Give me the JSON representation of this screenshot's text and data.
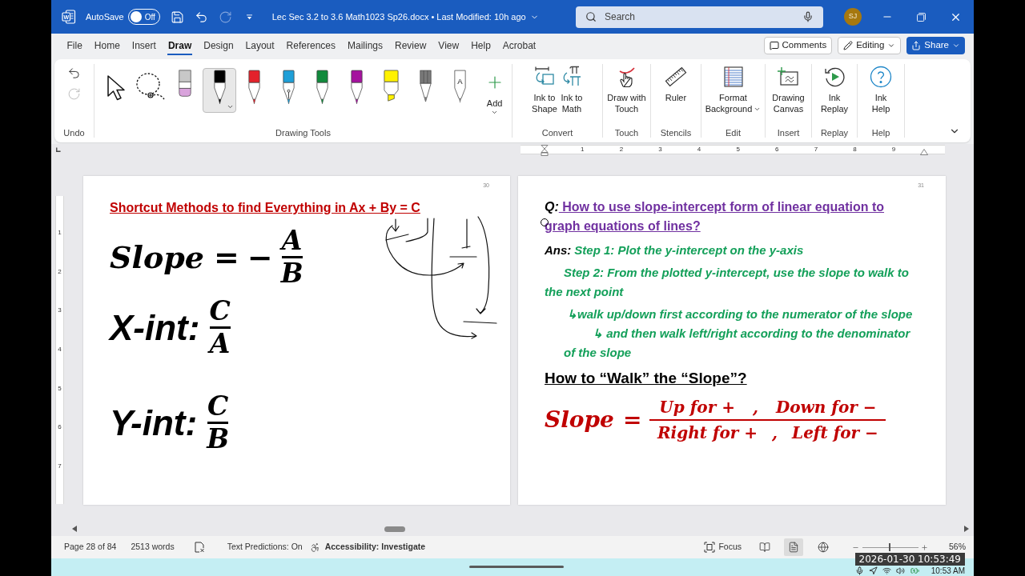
{
  "title_bar": {
    "logo_letter": "W",
    "autosave": {
      "label": "AutoSave",
      "on": false,
      "state_label": "Off"
    },
    "quick_access": [
      {
        "kind": "save",
        "disabled": false
      },
      {
        "kind": "undo",
        "disabled": false
      },
      {
        "kind": "redo",
        "disabled": true
      },
      {
        "kind": "customize",
        "disabled": false
      }
    ],
    "document_title": "Lec Sec 3.2 to 3.6 Math1023 Sp26.docx • Last Modified: 10h ago",
    "search": {
      "placeholder": "Search"
    },
    "avatar": "SJ"
  },
  "menu_tabs": [
    {
      "label": "File",
      "selected": false
    },
    {
      "label": "Home",
      "selected": false
    },
    {
      "label": "Insert",
      "selected": false
    },
    {
      "label": "Draw",
      "selected": true
    },
    {
      "label": "Design",
      "selected": false
    },
    {
      "label": "Layout",
      "selected": false
    },
    {
      "label": "References",
      "selected": false
    },
    {
      "label": "Mailings",
      "selected": false
    },
    {
      "label": "Review",
      "selected": false
    },
    {
      "label": "View",
      "selected": false
    },
    {
      "label": "Help",
      "selected": false
    },
    {
      "label": "Acrobat",
      "selected": false
    }
  ],
  "header_buttons": [
    {
      "kind": "comments",
      "label": "Comments"
    },
    {
      "kind": "editing",
      "label": "Editing"
    },
    {
      "kind": "share",
      "label": "Share"
    }
  ],
  "ribbon": {
    "undo_group": {
      "label": "Undo",
      "buttons": [
        {
          "kind": "undo",
          "disabled": false
        },
        {
          "kind": "redo",
          "disabled": true
        }
      ]
    },
    "drawing_tools": {
      "label": "Drawing Tools",
      "tools": [
        {
          "kind": "select",
          "selected": false
        },
        {
          "kind": "lasso",
          "selected": false
        },
        {
          "kind": "eraser",
          "selected": false
        },
        {
          "kind": "pen",
          "color": "#000000",
          "selected": true
        },
        {
          "kind": "pen",
          "color": "#e4222b",
          "selected": false
        },
        {
          "kind": "fountain_pen",
          "color": "#1e9fd8",
          "selected": false
        },
        {
          "kind": "pen",
          "color": "#118a3c",
          "selected": false
        },
        {
          "kind": "pen",
          "color": "#a5129e",
          "selected": false
        },
        {
          "kind": "highlighter",
          "color": "#fff200",
          "selected": false
        },
        {
          "kind": "pencil",
          "color": "#7a7a7a",
          "selected": false
        },
        {
          "kind": "action_pen",
          "letter": "A",
          "selected": false
        }
      ],
      "add_label": "Add"
    },
    "groups": [
      {
        "label": "Convert",
        "buttons": [
          {
            "kind": "ink_to_shape",
            "lines": [
              "Ink to",
              "Shape"
            ]
          },
          {
            "kind": "ink_to_math",
            "lines": [
              "Ink to",
              "Math"
            ]
          }
        ]
      },
      {
        "label": "Touch",
        "buttons": [
          {
            "kind": "draw_with_touch",
            "lines": [
              "Draw with",
              "Touch"
            ]
          }
        ]
      },
      {
        "label": "Stencils",
        "buttons": [
          {
            "kind": "ruler",
            "lines": [
              "Ruler"
            ]
          }
        ]
      },
      {
        "label": "Edit",
        "buttons": [
          {
            "kind": "format_background",
            "lines": [
              "Format",
              "Background"
            ],
            "dropdown": true
          }
        ]
      },
      {
        "label": "Insert",
        "buttons": [
          {
            "kind": "drawing_canvas",
            "lines": [
              "Drawing",
              "Canvas"
            ]
          }
        ]
      },
      {
        "label": "Replay",
        "buttons": [
          {
            "kind": "ink_replay",
            "lines": [
              "Ink",
              "Replay"
            ]
          }
        ]
      },
      {
        "label": "Help",
        "buttons": [
          {
            "kind": "ink_help",
            "lines": [
              "Ink",
              "Help"
            ]
          }
        ]
      }
    ]
  },
  "ruler": {
    "horizontal": [
      "1",
      "2",
      "3",
      "4",
      "5",
      "6",
      "7",
      "8",
      "9"
    ],
    "vertical": [
      "1",
      "2",
      "3",
      "4",
      "5",
      "6",
      "7"
    ]
  },
  "left_page": {
    "page_number": "30",
    "title": "Shortcut Methods to find Everything in Ax + By = C",
    "formulas": [
      {
        "kind": "equation",
        "lhs": "Slope",
        "relation": "=",
        "sign": "−",
        "numerator": "A",
        "denominator": "B"
      },
      {
        "kind": "label",
        "lhs": "X-int:",
        "numerator": "C",
        "denominator": "A"
      },
      {
        "kind": "label",
        "lhs": "Y-int:",
        "numerator": "C",
        "denominator": "B"
      }
    ]
  },
  "right_page": {
    "page_number": "31",
    "question": {
      "text": "*Q:* How to use slope-intercept form of linear equation to graph equations of lines?"
    },
    "answer": {
      "label": "Ans:",
      "steps": [
        {
          "text": "Step 1: Plot the y-intercept on the y-axis"
        },
        {
          "text": "Step 2: From the plotted y-intercept, use the slope to walk to the next point",
          "children": [
            {
              "text": "↳walk up/down first according to the numerator of the slope",
              "children": [
                {
                  "text": "↳ and then walk left/right according to the denominator of the slope"
                }
              ]
            }
          ]
        }
      ]
    },
    "heading": "How to “Walk” the “Slope”?",
    "formula": {
      "lhs": "Slope",
      "relation": "=",
      "numerator": [
        "Up for +",
        ",",
        "Down for −"
      ],
      "denominator": [
        "Right for +",
        ",",
        "Left for −"
      ]
    }
  },
  "status_bar": {
    "page": "Page 28 of 84",
    "words": "2513 words",
    "text_predictions": "Text Predictions: On",
    "accessibility": "Accessibility: Investigate",
    "focus": "Focus",
    "views": [
      {
        "kind": "read",
        "selected": false
      },
      {
        "kind": "print",
        "selected": true
      },
      {
        "kind": "web",
        "selected": false
      }
    ],
    "zoom": {
      "level": 0.49,
      "reading": "56%"
    }
  },
  "taskbar": {
    "clock": "10:53 AM"
  },
  "recording_timestamp": "2026-01-30 10:53:49"
}
